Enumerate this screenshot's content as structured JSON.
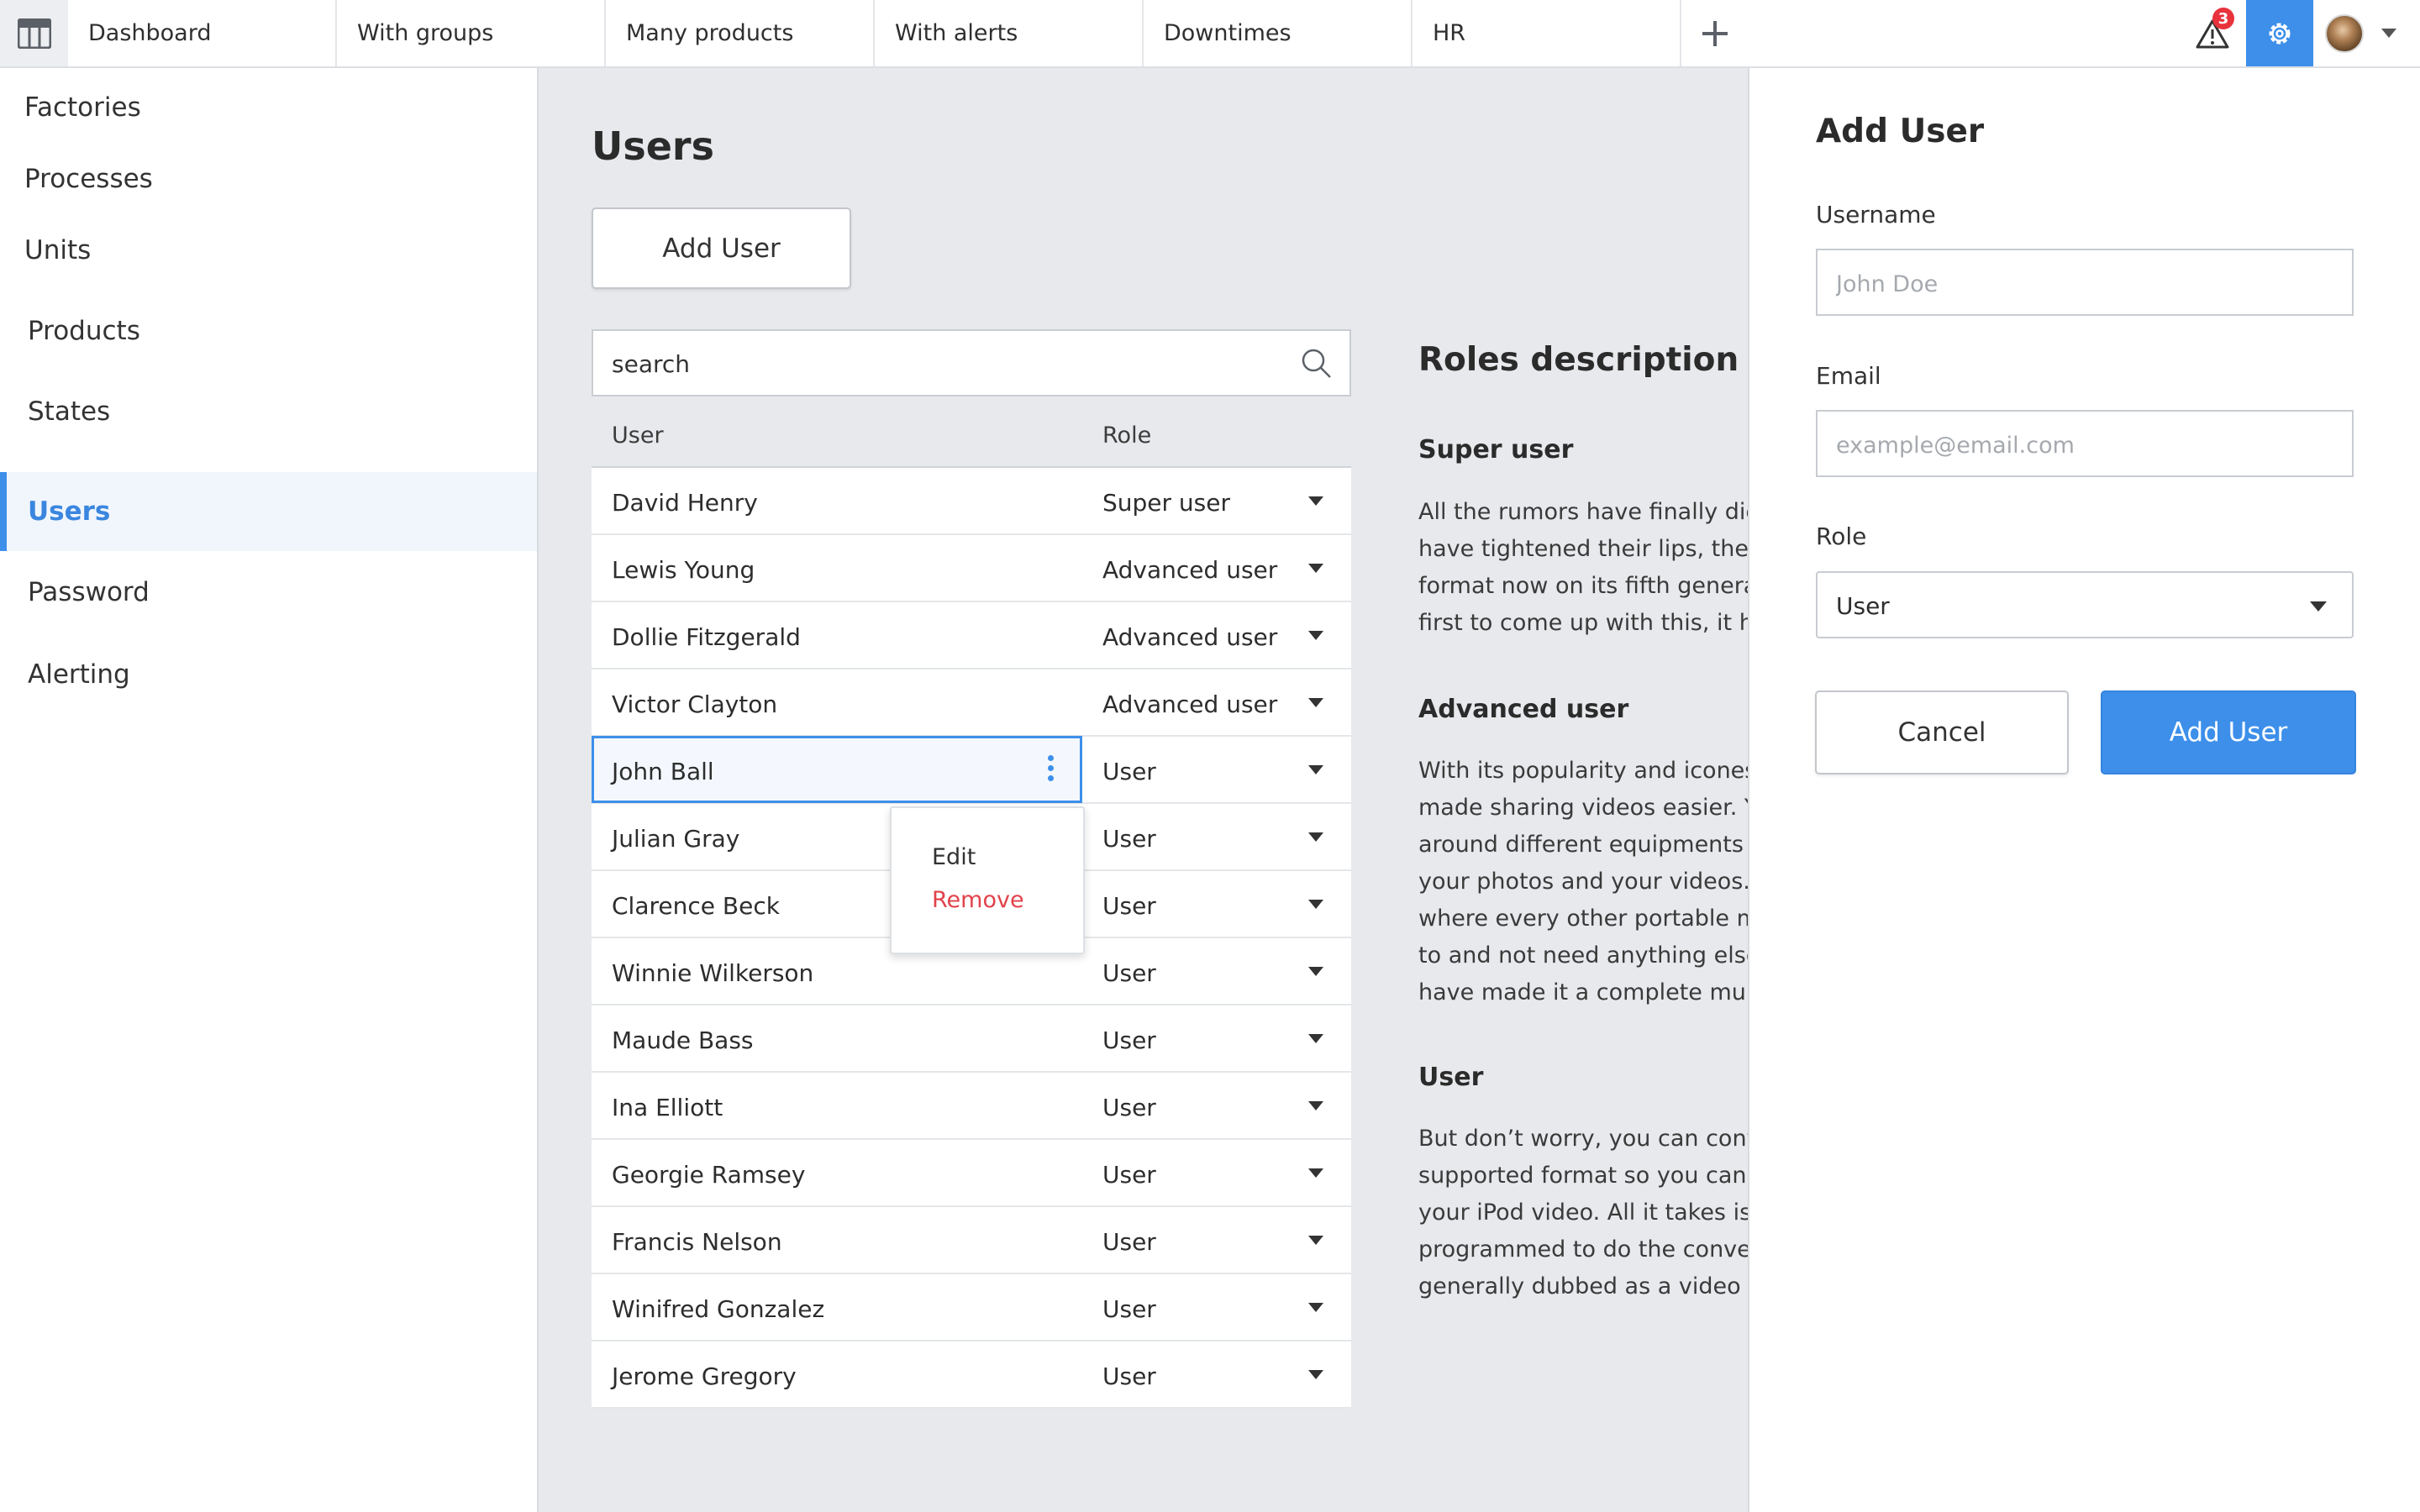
{
  "topbar": {
    "tabs": [
      "Dashboard",
      "With groups",
      "Many products",
      "With alerts",
      "Downtimes",
      "HR"
    ],
    "alert_count": "3",
    "icons": {
      "menu": "grid-icon",
      "add_tab": "plus-icon",
      "alerts": "warning-icon",
      "settings": "gear-icon",
      "avatar_menu": "chevron-down-icon"
    }
  },
  "sidebar": {
    "items": [
      {
        "label": "Factories"
      },
      {
        "label": "Processes"
      },
      {
        "label": "Units"
      },
      {
        "label": "Products"
      },
      {
        "label": "States"
      },
      {
        "label": "Users",
        "active": true
      },
      {
        "label": "Password"
      },
      {
        "label": "Alerting"
      }
    ]
  },
  "main": {
    "title": "Users",
    "add_user_label": "Add User",
    "search": {
      "value": "",
      "placeholder": "search"
    },
    "table": {
      "headers": {
        "user": "User",
        "role": "Role"
      },
      "rows": [
        {
          "user": "David Henry",
          "role": "Super user"
        },
        {
          "user": "Lewis Young",
          "role": "Advanced user"
        },
        {
          "user": "Dollie Fitzgerald",
          "role": "Advanced user"
        },
        {
          "user": "Victor Clayton",
          "role": "Advanced user"
        },
        {
          "user": "John Ball",
          "role": "User",
          "selected": true
        },
        {
          "user": "Julian Gray",
          "role": "User"
        },
        {
          "user": "Clarence Beck",
          "role": "User"
        },
        {
          "user": "Winnie Wilkerson",
          "role": "User"
        },
        {
          "user": "Maude Bass",
          "role": "User"
        },
        {
          "user": "Ina Elliott",
          "role": "User"
        },
        {
          "user": "Georgie Ramsey",
          "role": "User"
        },
        {
          "user": "Francis Nelson",
          "role": "User"
        },
        {
          "user": "Winifred Gonzalez",
          "role": "User"
        },
        {
          "user": "Jerome Gregory",
          "role": "User"
        }
      ]
    },
    "context_menu": {
      "edit": "Edit",
      "remove": "Remove"
    }
  },
  "roles": {
    "title": "Roles description",
    "sections": [
      {
        "heading": "Super user",
        "lines": [
          "All the rumors have finally died",
          "have tightened their lips, the iP",
          "format now on its fifth generatio",
          "first to come up with this, it has"
        ]
      },
      {
        "heading": "Advanced user",
        "lines": [
          "With its popularity and iconesq",
          "made sharing videos easier. You",
          "around different equipments fo",
          "your photos and your videos. Yo",
          "where every other portable mul",
          "to and not need anything else. V",
          "have made it a complete multi r"
        ]
      },
      {
        "heading": "User",
        "lines": [
          "But don’t worry, you can conver",
          "supported format so you can st",
          "your iPod video. All it takes is a",
          "programmed to do the conversi",
          "generally dubbed as a video co"
        ]
      }
    ]
  },
  "panel": {
    "title": "Add User",
    "username": {
      "label": "Username",
      "value": "",
      "placeholder": "John Doe"
    },
    "email": {
      "label": "Email",
      "value": "",
      "placeholder": "example@email.com"
    },
    "role": {
      "label": "Role",
      "value": "User"
    },
    "cancel_label": "Cancel",
    "submit_label": "Add User"
  },
  "colors": {
    "accent": "#3d8fea",
    "danger": "#e2424b",
    "badge": "#e8323c"
  }
}
